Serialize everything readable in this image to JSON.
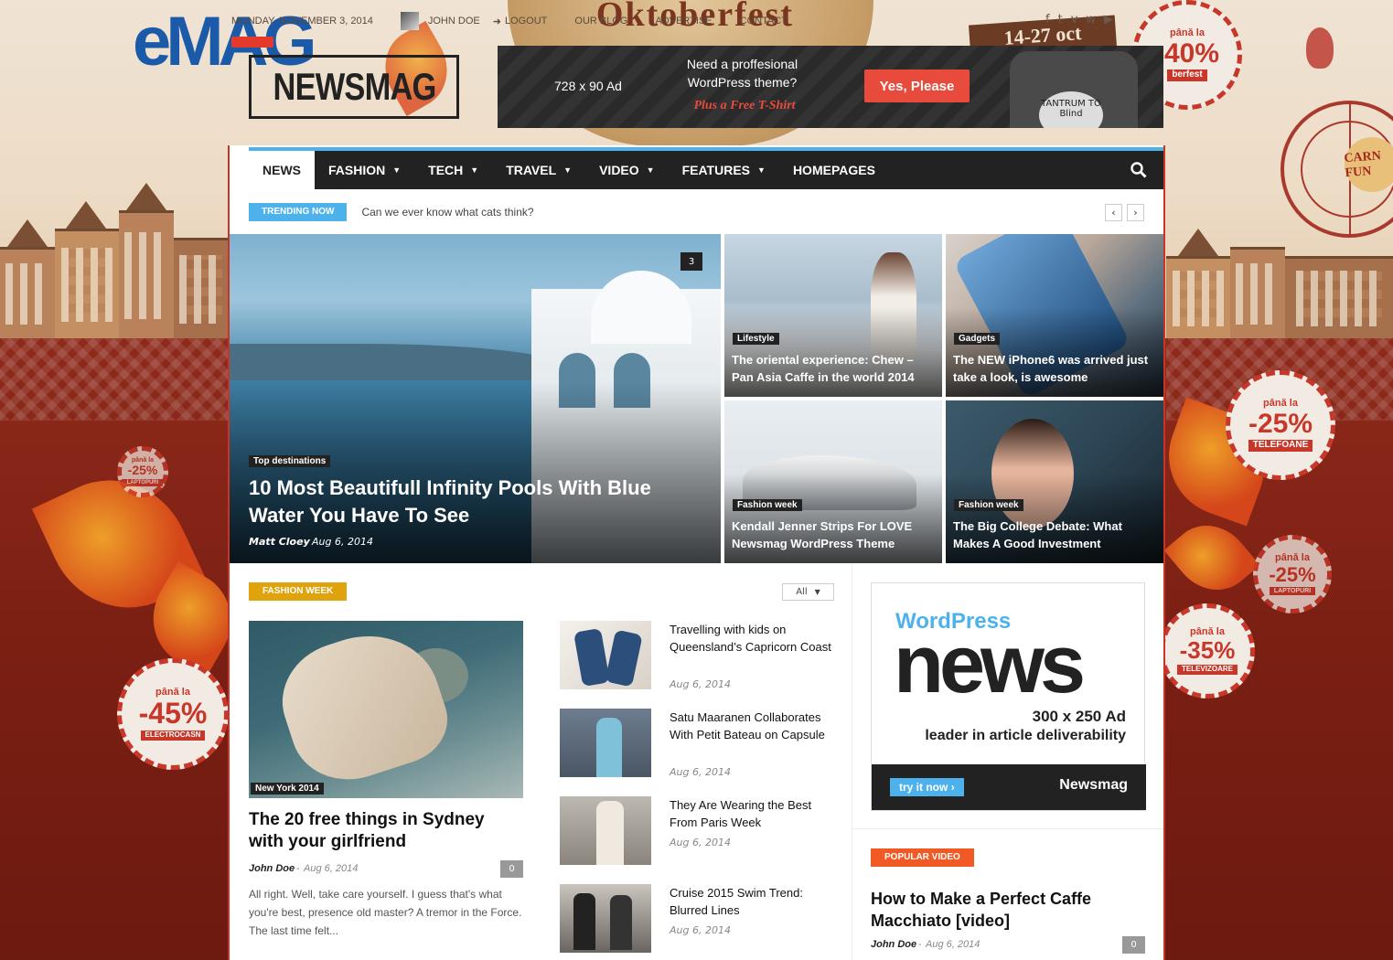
{
  "header": {
    "date": "MONDAY, NOVEMBER 3, 2014",
    "user": "JOHN DOE",
    "logout": "LOGOUT",
    "links": [
      "OUR BLOG",
      "ADVERTISE",
      "CONTACT"
    ],
    "logo": "NEWSMAG"
  },
  "background": {
    "brand": "eMAG",
    "festival": "Oktoberfest",
    "dates": "14-27 oct",
    "badges": [
      {
        "small": "până la",
        "big": "-40%",
        "ribbon": "berfest"
      },
      {
        "small": "până la",
        "big": "-25%",
        "ribbon": "TELEFOANE"
      },
      {
        "small": "până la",
        "big": "-25%",
        "ribbon": "LAPTOPURI"
      },
      {
        "small": "până la",
        "big": "-25%",
        "ribbon": "LAPTOPURI"
      },
      {
        "small": "până la",
        "big": "-35%",
        "ribbon": "TELEVIZOARE"
      },
      {
        "small": "până la",
        "big": "-45%",
        "ribbon": "ELECTROCASN"
      }
    ],
    "carnival": "CARN FUN"
  },
  "top_ad": {
    "size": "728 x 90 Ad",
    "message": "Need a proffesional WordPress theme?",
    "promo": "Plus a Free T-Shirt",
    "button": "Yes, Please",
    "shirt": "TANTRUM TO Blind"
  },
  "nav": {
    "items": [
      {
        "label": "NEWS",
        "dropdown": false
      },
      {
        "label": "FASHION",
        "dropdown": true
      },
      {
        "label": "TECH",
        "dropdown": true
      },
      {
        "label": "TRAVEL",
        "dropdown": true
      },
      {
        "label": "VIDEO",
        "dropdown": true
      },
      {
        "label": "FEATURES",
        "dropdown": true
      },
      {
        "label": "HOMEPAGES",
        "dropdown": false
      }
    ]
  },
  "trending": {
    "label": "TRENDING NOW",
    "text": "Can we ever know what cats think?"
  },
  "featured": {
    "main": {
      "category": "Top destinations",
      "title": "10 Most Beautifull Infinity Pools With Blue Water You Have To See",
      "author": "Matt Cloey",
      "date": "Aug 6, 2014",
      "comments": "3"
    },
    "tiles": [
      {
        "category": "Lifestyle",
        "title": "The oriental experience: Chew – Pan Asia Caffe in the world 2014"
      },
      {
        "category": "Gadgets",
        "title": "The NEW iPhone6 was arrived just take a look, is awesome"
      },
      {
        "category": "Fashion week",
        "title": "Kendall Jenner Strips For LOVE Newsmag WordPress Theme"
      },
      {
        "category": "Fashion week",
        "title": "The Big College Debate: What Makes A Good Investment"
      }
    ]
  },
  "fashion_block": {
    "label": "FASHION WEEK",
    "filter": "All",
    "main": {
      "category": "New York 2014",
      "title": "The 20 free things in Sydney with your girlfriend",
      "author": "John Doe",
      "date": "Aug 6, 2014",
      "comments": "0",
      "excerpt": "All right. Well, take care yourself. I guess that's what you're best, presence old master? A tremor in the Force. The last time felt..."
    },
    "list": [
      {
        "title": "Travelling with kids on Queensland’s Capricorn Coast",
        "date": "Aug 6, 2014"
      },
      {
        "title": "Satu Maaranen Collaborates With Petit Bateau on Capsule",
        "date": "Aug 6, 2014"
      },
      {
        "title": "They Are Wearing the Best From Paris Week",
        "date": "Aug 6, 2014"
      },
      {
        "title": "Cruise 2015 Swim Trend: Blurred Lines",
        "date": "Aug 6, 2014"
      }
    ]
  },
  "side_ad": {
    "wp": "WordPress",
    "news": "news",
    "size": "300 x 250 Ad",
    "tagline": "leader in article deliverability",
    "button": "try it now",
    "brand": "Newsmag"
  },
  "popular_video": {
    "label": "POPULAR VIDEO",
    "title": "How to Make a Perfect Caffe Macchiato [video]",
    "author": "John Doe",
    "date": "Aug 6, 2014",
    "comments": "0"
  },
  "colors": {
    "accent": "#4db2ec",
    "orange": "#e0a30d",
    "red": "#e84b3c",
    "popular": "#f15a24",
    "nav": "#222222"
  }
}
